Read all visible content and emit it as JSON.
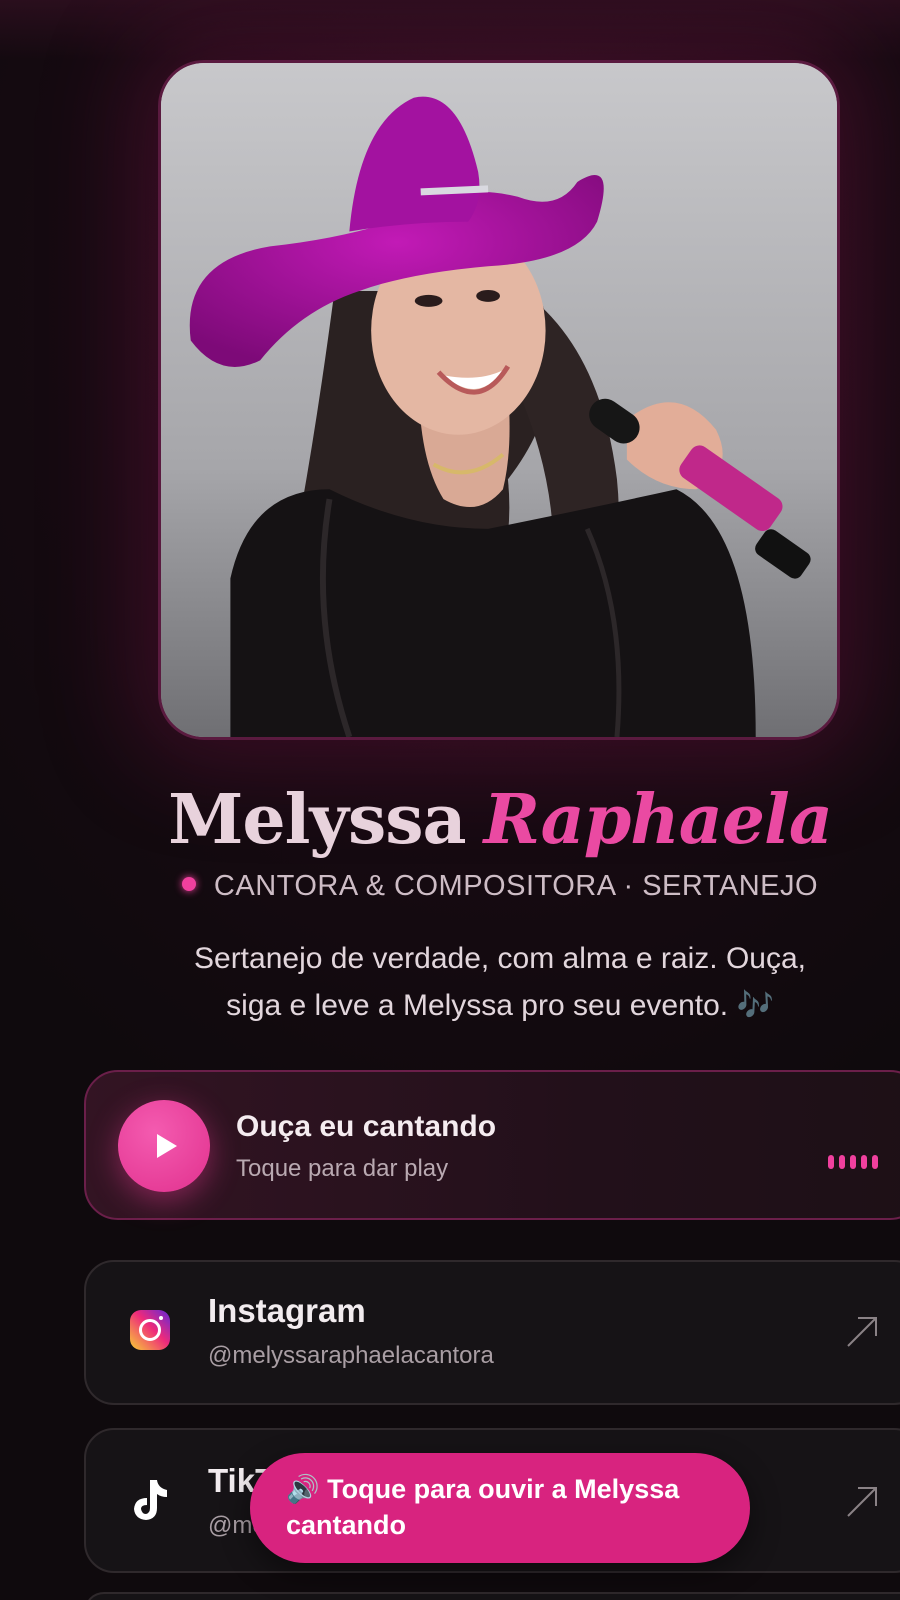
{
  "profile": {
    "first_name": "Melyssa",
    "last_name": "Raphaela",
    "tagline": "CANTORA & COMPOSITORA · SERTANEJO",
    "bio_line1": "Sertanejo de verdade, com alma e raiz. Ouça,",
    "bio_line2": "siga e leve a Melyssa pro seu evento. 🎶"
  },
  "player": {
    "title": "Ouça eu cantando",
    "subtitle": "Toque para dar play",
    "icon": "play-icon"
  },
  "links": [
    {
      "name": "Instagram",
      "handle": "@melyssaraphaelacantora",
      "icon": "instagram-icon"
    },
    {
      "name": "TikTok",
      "handle": "@melyssaraphaelacantora",
      "icon": "tiktok-icon"
    }
  ],
  "toast": {
    "text": "🔊 Toque para ouvir a Melyssa cantando"
  },
  "colors": {
    "accent": "#ea4aa2",
    "toast_bg": "#d8237f",
    "background": "#0f0a0d",
    "hat": "#a00c9a"
  }
}
